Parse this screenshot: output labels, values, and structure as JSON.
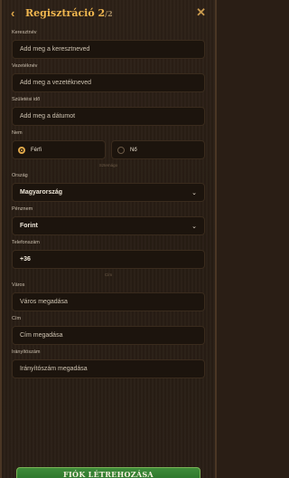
{
  "header": {
    "back_icon": "chevron-left-icon",
    "title": "Regisztráció 2",
    "step": "/2",
    "close_icon": "close-icon"
  },
  "form": {
    "first_name": {
      "label": "Keresztnév",
      "placeholder": "Add meg a keresztneved"
    },
    "last_name": {
      "label": "Vezetéknév",
      "placeholder": "Add meg a vezetékneved"
    },
    "birth_date": {
      "label": "Születési idő",
      "placeholder": "Add meg a dátumot"
    },
    "gender": {
      "label": "Nem",
      "options": [
        "Férfi",
        "Nő"
      ],
      "selected": "Férfi",
      "hint": "Sztemágo"
    },
    "country": {
      "label": "Ország",
      "value": "Magyarország"
    },
    "currency": {
      "label": "Pénznem",
      "value": "Forint"
    },
    "phone": {
      "label": "Telefonszám",
      "value": "+36",
      "hint": "Cím"
    },
    "city": {
      "label": "Város",
      "placeholder": "Város megadása"
    },
    "address": {
      "label": "Cím",
      "placeholder": "Cím megadása"
    },
    "zip": {
      "label": "Irányítószám",
      "placeholder": "Irányítószám megadása"
    }
  },
  "submit_label": "FIÓK LÉTREHOZÁSA",
  "colors": {
    "accent": "#f0b64f",
    "submit": "#2f7a2d"
  }
}
